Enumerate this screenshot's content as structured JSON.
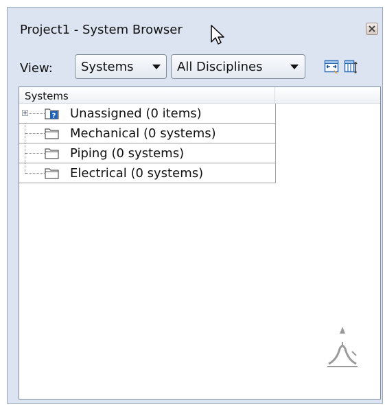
{
  "window": {
    "title": "Project1 - System Browser"
  },
  "toolbar": {
    "view_label": "View:",
    "view_select": {
      "selected": "Systems"
    },
    "discipline_select": {
      "selected": "All Disciplines"
    },
    "icons": [
      "autofit-columns-icon",
      "column-settings-icon"
    ]
  },
  "tree": {
    "column_header": "Systems",
    "rows": [
      {
        "label": "Unassigned (0 items)",
        "icon": "unassigned-folder-icon",
        "expandable": true
      },
      {
        "label": "Mechanical (0 systems)",
        "icon": "folder-icon",
        "expandable": false
      },
      {
        "label": "Piping (0 systems)",
        "icon": "folder-icon",
        "expandable": false
      },
      {
        "label": "Electrical (0 systems)",
        "icon": "folder-icon",
        "expandable": false
      }
    ]
  },
  "colors": {
    "panel_bg": "#dbe4f0",
    "tree_bg": "#ffffff",
    "border": "#7f8c9c",
    "accent_blue": "#2f6db5",
    "accent_orange": "#e8a030"
  }
}
